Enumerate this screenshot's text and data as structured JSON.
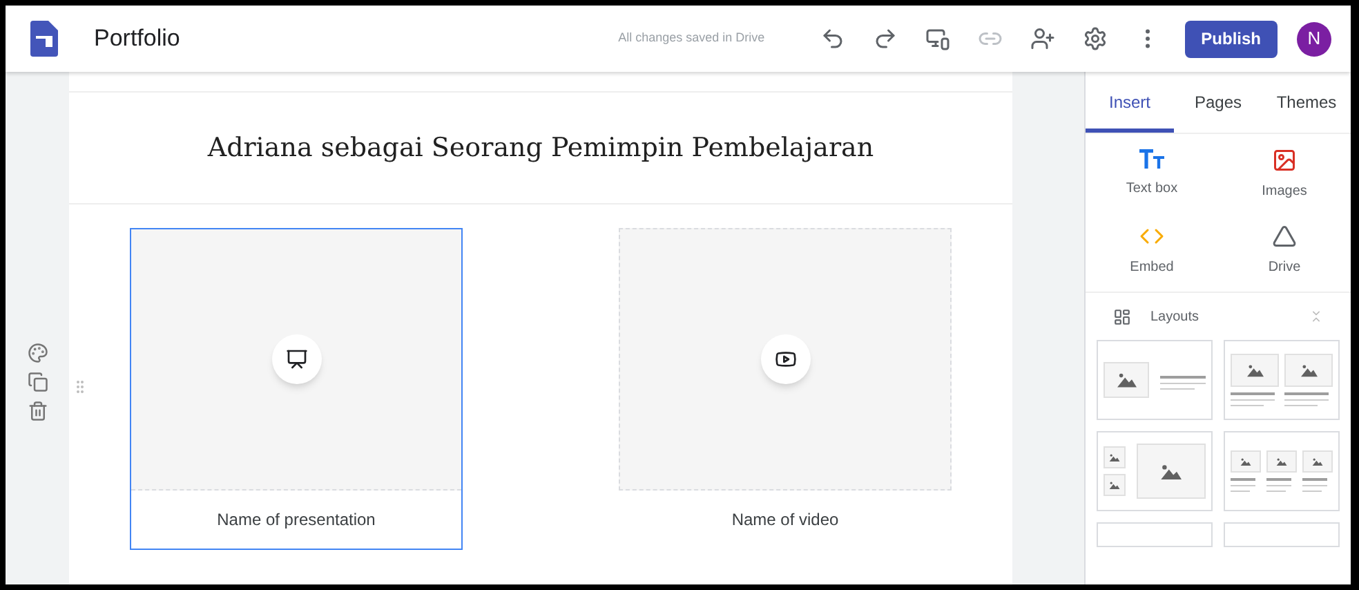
{
  "header": {
    "title": "Portfolio",
    "save_status": "All changes saved in Drive",
    "publish": "Publish",
    "avatar": "N"
  },
  "page": {
    "heading": "Adriana sebagai Seorang Pemimpin Pembelajaran",
    "media": [
      {
        "kind": "presentation",
        "caption": "Name of presentation",
        "selected": true
      },
      {
        "kind": "video",
        "caption": "Name of video",
        "selected": false
      }
    ]
  },
  "panel": {
    "tabs": [
      {
        "label": "Insert",
        "selected": true
      },
      {
        "label": "Pages",
        "selected": false
      },
      {
        "label": "Themes",
        "selected": false
      }
    ],
    "insert_items": [
      {
        "kind": "textbox",
        "label": "Text box"
      },
      {
        "kind": "images",
        "label": "Images"
      },
      {
        "kind": "embed",
        "label": "Embed"
      },
      {
        "kind": "drive",
        "label": "Drive"
      }
    ],
    "layouts_label": "Layouts"
  }
}
